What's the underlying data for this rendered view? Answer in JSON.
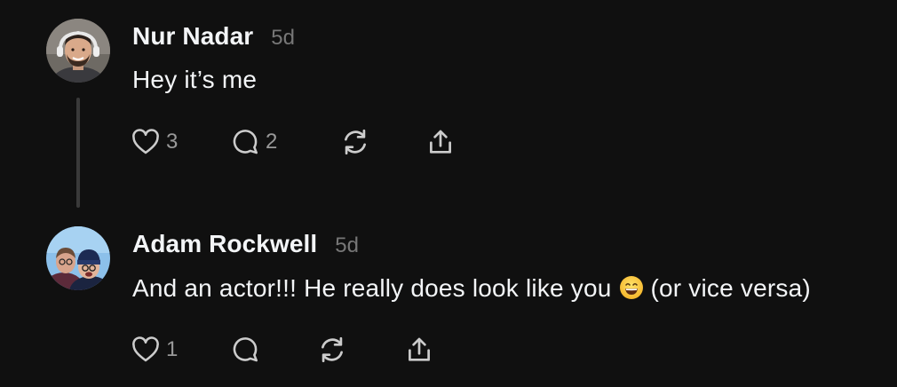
{
  "posts": [
    {
      "username": "Nur Nadar",
      "timestamp": "5d",
      "text": "Hey it’s me",
      "likes": "3",
      "replies": "2"
    },
    {
      "username": "Adam Rockwell",
      "timestamp": "5d",
      "text_before_emoji": "And an actor!!! He really does look like you",
      "emoji": "😄",
      "text_after_emoji": " (or vice versa)",
      "likes": "1",
      "replies": ""
    }
  ],
  "colors": {
    "background": "#101010",
    "primary_text": "#f3f5f7",
    "secondary_text": "#777777",
    "icon": "#cccccc",
    "thread_line": "#3a3a3a"
  },
  "icons": [
    "heart-icon",
    "comment-icon",
    "repost-icon",
    "share-icon"
  ]
}
